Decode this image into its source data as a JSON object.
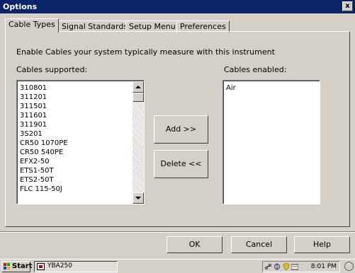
{
  "window": {
    "title": "Options",
    "close_label": "x"
  },
  "tabs": [
    {
      "label": "Cable Types",
      "active": true
    },
    {
      "label": "Signal Standards",
      "active": false
    },
    {
      "label": "Setup Menu",
      "active": false
    },
    {
      "label": "Preferences",
      "active": false
    }
  ],
  "cable_types": {
    "instruction": "Enable Cables your system typically measure with this instrument",
    "supported_label": "Cables supported:",
    "enabled_label": "Cables enabled:",
    "supported": [
      "310801",
      "311201",
      "311501",
      "311601",
      "311901",
      "3S201",
      "CR50 1070PE",
      "CR50 540PE",
      "EFX2-50",
      "ETS1-50T",
      "ETS2-50T",
      "FLC 115-50J"
    ],
    "enabled": [
      "Air"
    ],
    "add_label": "Add >>",
    "delete_label": "Delete <<"
  },
  "dialog_buttons": {
    "ok": "OK",
    "cancel": "Cancel",
    "help": "Help"
  },
  "taskbar": {
    "start_label": "Start",
    "task_label": "YBA250",
    "clock": "8:01 PM"
  },
  "colors": {
    "titlebar": "#0a246a",
    "face": "#d4d0c8"
  }
}
